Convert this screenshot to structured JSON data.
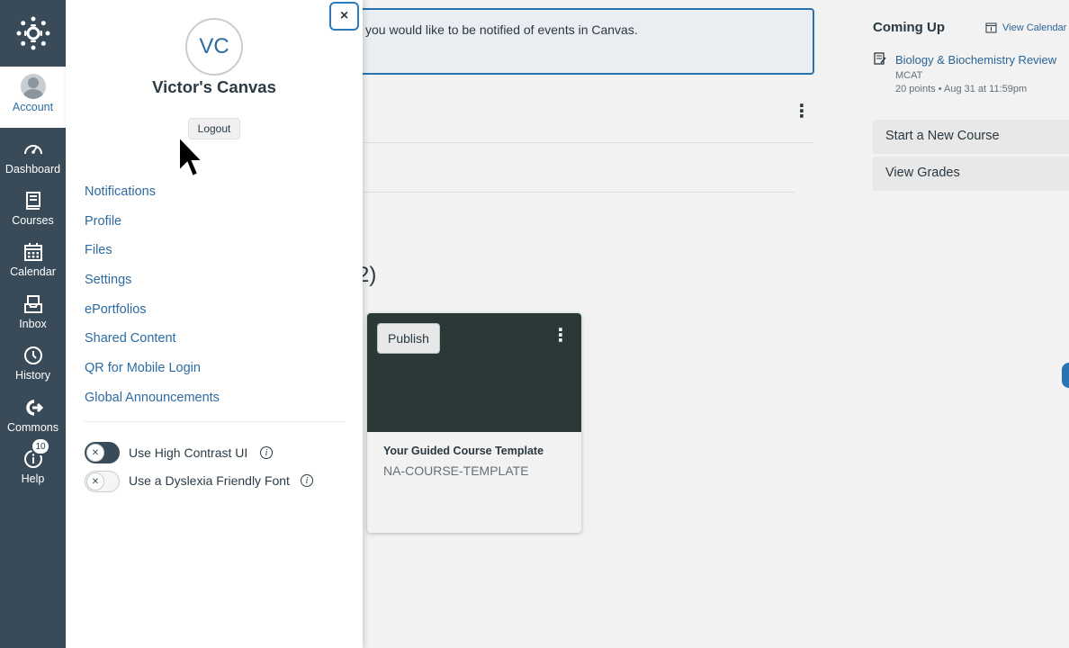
{
  "global_nav": {
    "items": [
      {
        "id": "account",
        "label": "Account"
      },
      {
        "id": "dashboard",
        "label": "Dashboard"
      },
      {
        "id": "courses",
        "label": "Courses"
      },
      {
        "id": "calendar",
        "label": "Calendar"
      },
      {
        "id": "inbox",
        "label": "Inbox"
      },
      {
        "id": "history",
        "label": "History"
      },
      {
        "id": "commons",
        "label": "Commons"
      },
      {
        "id": "help",
        "label": "Help"
      }
    ],
    "help_badge": "10",
    "bg_color": "#394b58"
  },
  "tray": {
    "initials": "VC",
    "name": "Victor's Canvas",
    "logout_label": "Logout",
    "close_label": "×",
    "links": [
      "Notifications",
      "Profile",
      "Files",
      "Settings",
      "ePortfolios",
      "Shared Content",
      "QR for Mobile Login",
      "Global Announcements"
    ],
    "toggles": [
      {
        "label": "Use High Contrast UI",
        "state": "off"
      },
      {
        "label": "Use a Dyslexia Friendly Font",
        "state": "off"
      }
    ]
  },
  "main": {
    "banner_text": "you would like to be notified of events in Canvas.",
    "partial_heading": "2)",
    "course_card": {
      "publish_label": "Publish",
      "title": "Your Guided Course Template",
      "code": "NA-COURSE-TEMPLATE",
      "hero_color": "#2d3d3c"
    }
  },
  "sidebar": {
    "coming_up": "Coming Up",
    "view_calendar": "View Calendar",
    "todo": {
      "title": "Biology & Biochemistry Review",
      "course": "MCAT",
      "meta": "20 points • Aug 31 at 11:59pm"
    },
    "buttons": [
      "Start a New Course",
      "View Grades"
    ]
  },
  "colors": {
    "link": "#2d6ba0",
    "focus": "#2b7abc",
    "text": "#2d3b45"
  }
}
